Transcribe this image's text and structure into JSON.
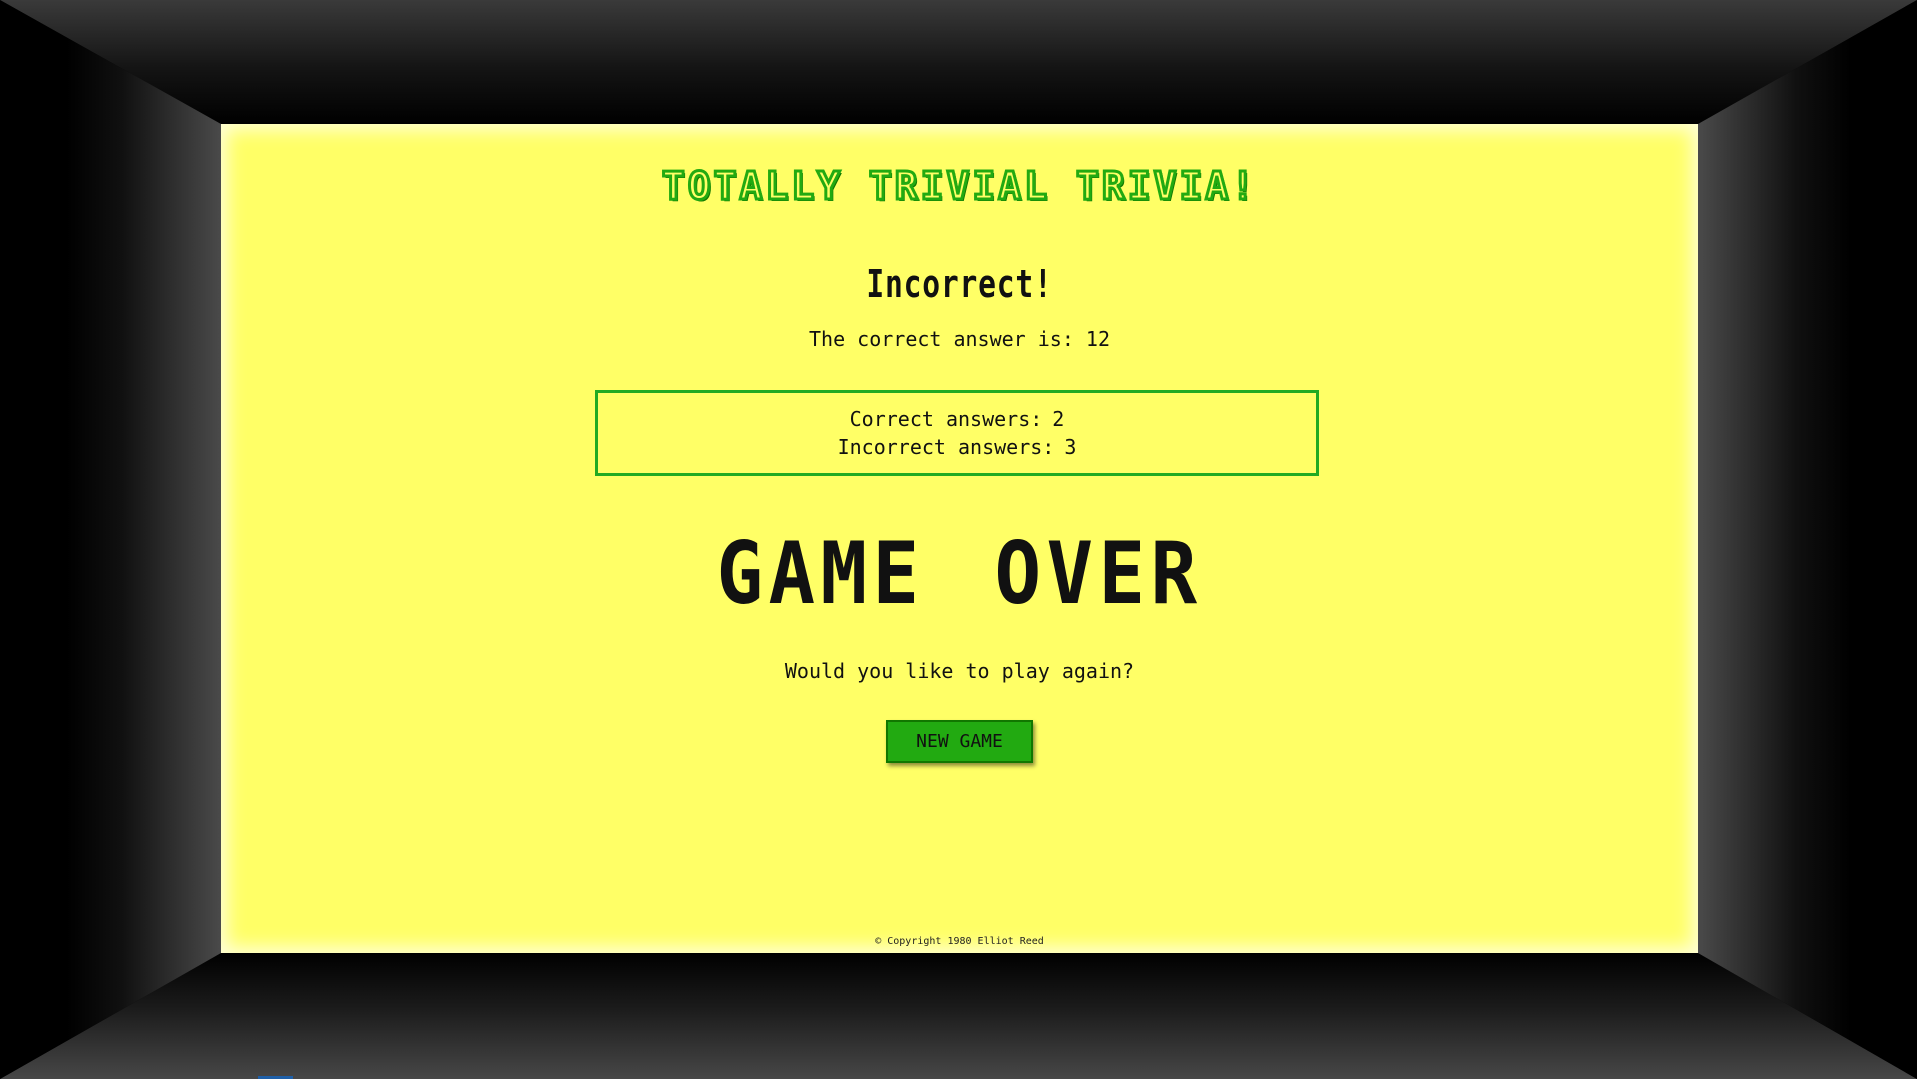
{
  "app": {
    "title": "Totally Trivial Trivia!"
  },
  "result": {
    "heading": "Incorrect!",
    "correct_answer_text": "The correct answer is: 12"
  },
  "score": {
    "correct_label": "Correct answers:",
    "correct_value": "2",
    "incorrect_label": "Incorrect answers:",
    "incorrect_value": "3"
  },
  "game_over": {
    "heading": "GAME OVER",
    "prompt": "Would you like to play again?",
    "button_label": "NEW GAME"
  },
  "footer": {
    "copyright": "© Copyright 1980 Elliot Reed"
  },
  "colors": {
    "screen_background": "#ffff66",
    "accent_green": "#22aa11",
    "text": "#111111",
    "bezel": "#000000"
  }
}
